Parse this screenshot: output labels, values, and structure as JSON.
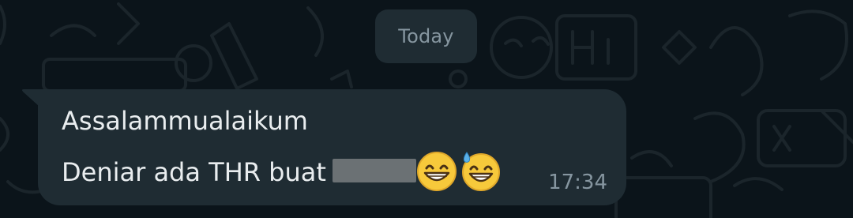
{
  "date_separator": {
    "label": "Today"
  },
  "message": {
    "line1": "Assalammualaikum",
    "line2_text": "Deniar ada THR buat",
    "redacted_word": "[redacted]",
    "emojis": [
      "grinning-face-with-smiling-eyes-emoji",
      "grinning-face-with-sweat-emoji"
    ],
    "time": "17:34"
  },
  "colors": {
    "background": "#0b141a",
    "bubble": "#1f2c33",
    "text": "#e9edef",
    "meta_text": "#8696a0"
  }
}
